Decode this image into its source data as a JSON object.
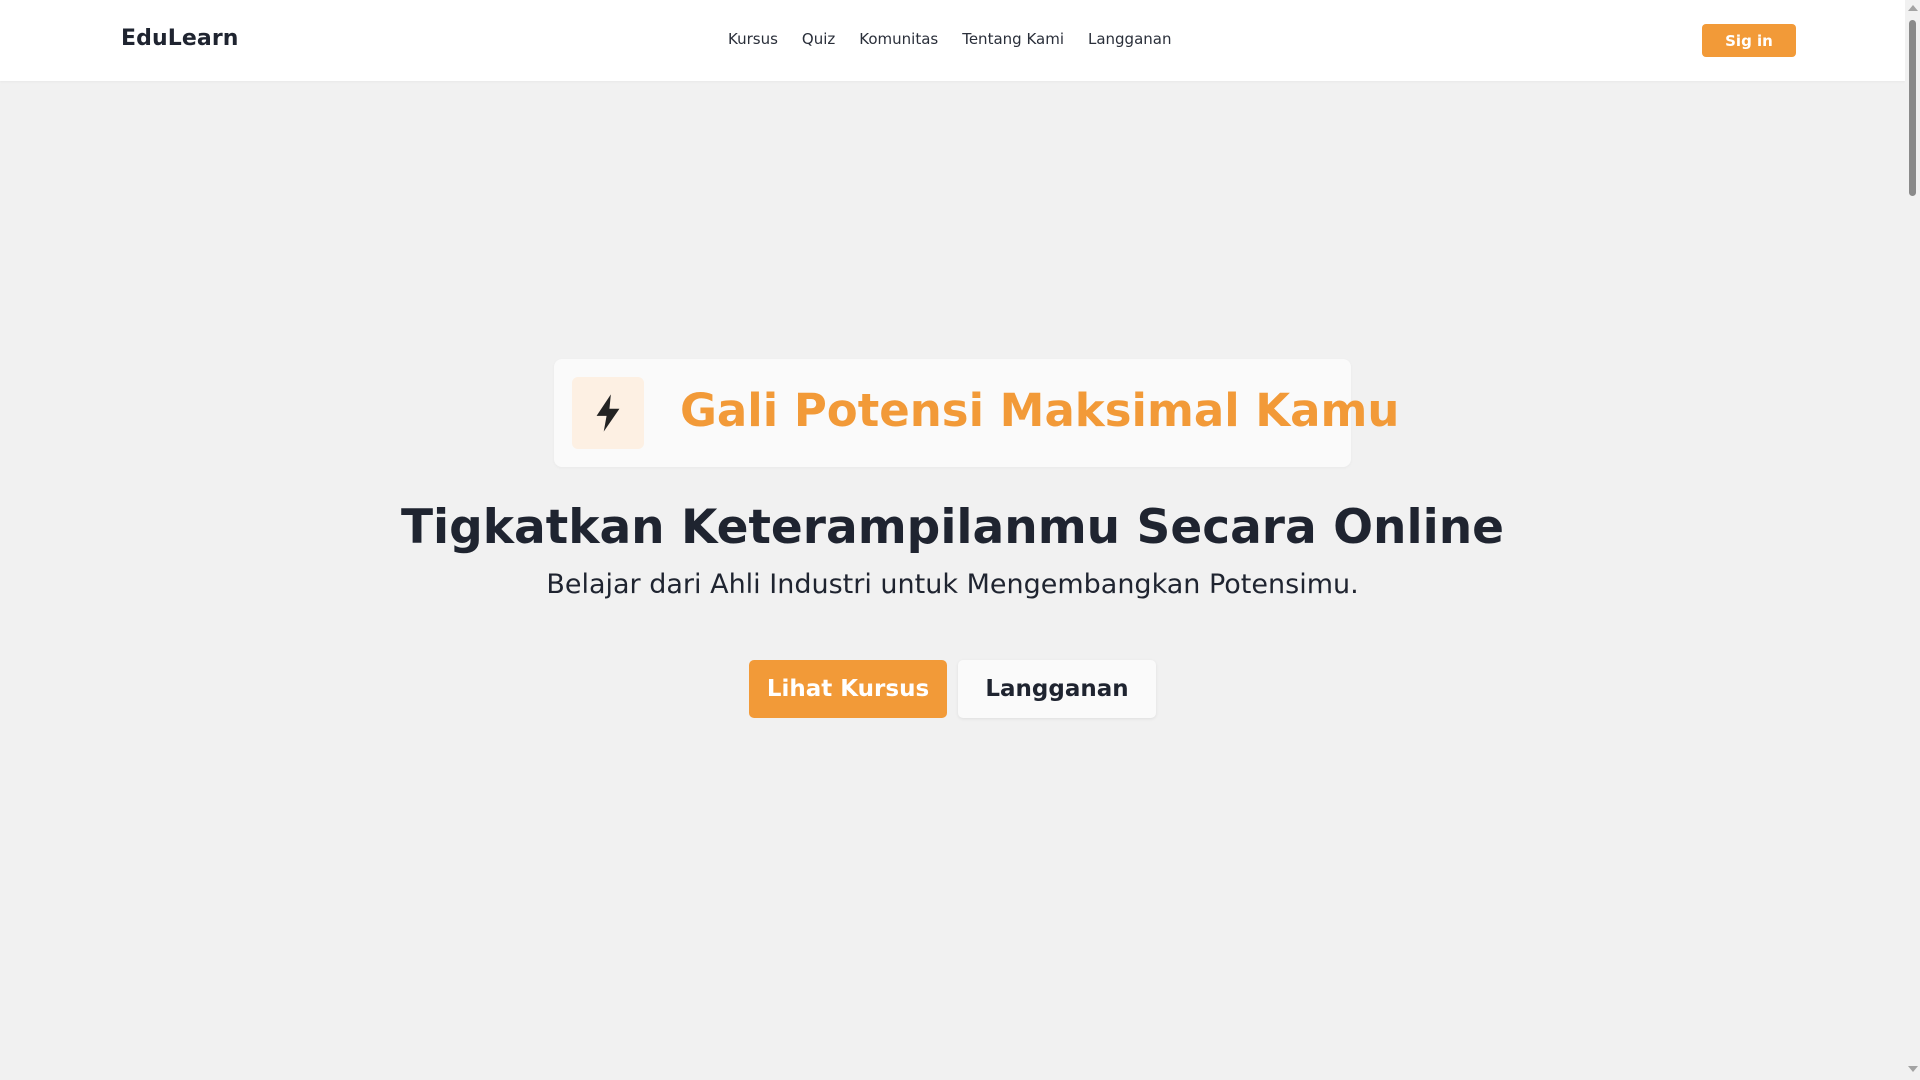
{
  "navbar": {
    "brand": "EduLearn",
    "links": [
      "Kursus",
      "Quiz",
      "Komunitas",
      "Tentang Kami",
      "Langganan"
    ],
    "signin_label": "Sig in"
  },
  "hero": {
    "badge_icon": "lightning-icon",
    "badge_text": "Gali Potensi Maksimal Kamu",
    "title": "Tigkatkan Keterampilanmu Secara Online",
    "subtitle": "Belajar dari Ahli Industri untuk Mengembangkan Potensimu.",
    "primary_cta": "Lihat Kursus",
    "secondary_cta": "Langganan"
  },
  "colors": {
    "accent": "#f29a38",
    "text_dark": "#1f2430",
    "background": "#f1f1f1",
    "badge_icon_bg": "#fdf0e3"
  }
}
